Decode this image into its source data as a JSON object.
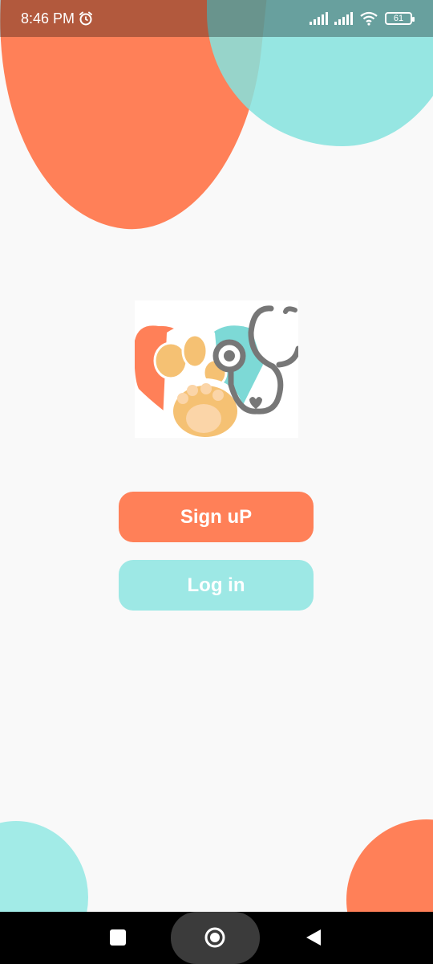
{
  "status_bar": {
    "time": "8:46 PM",
    "battery": "61",
    "icons": [
      "alarm-icon",
      "signal-icon",
      "signal-icon",
      "wifi-icon",
      "battery-icon"
    ]
  },
  "logo": {
    "icon": "pet-vet-logo"
  },
  "buttons": {
    "signup_label": "Sign uP",
    "login_label": "Log in"
  },
  "nav_bar": {
    "icons": [
      "recents-icon",
      "home-icon",
      "back-icon"
    ]
  },
  "colors": {
    "accent_orange": "#ff8058",
    "accent_teal": "#9de8e5",
    "background": "#f9f9f9"
  }
}
